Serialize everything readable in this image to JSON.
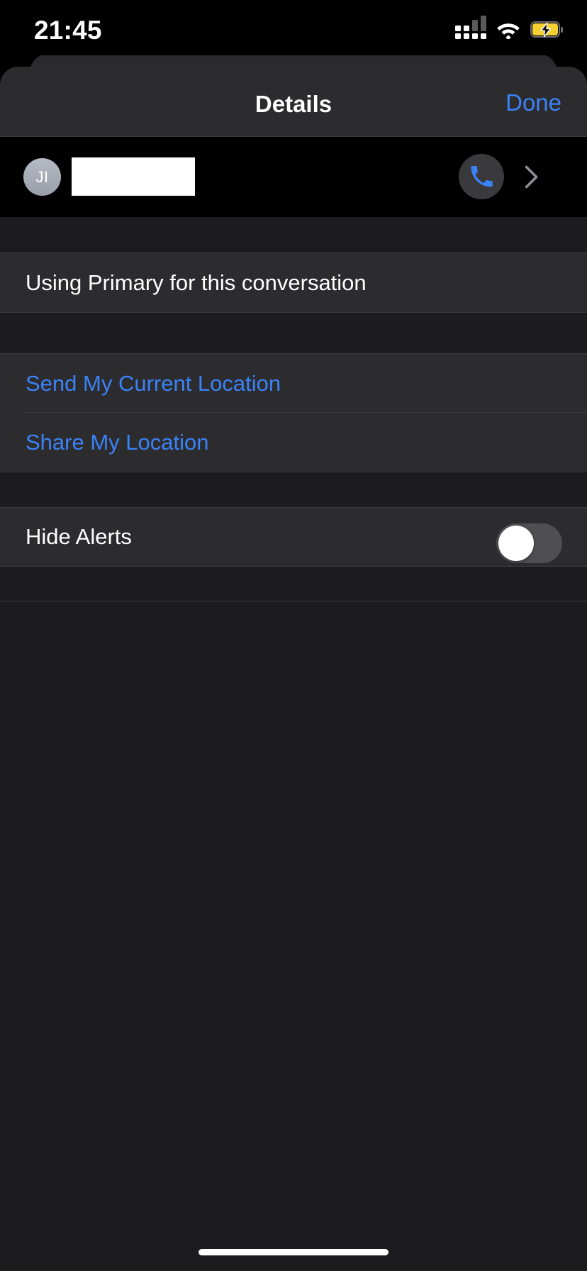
{
  "status_bar": {
    "time": "21:45",
    "signal_icon": "cellular-signal-dual-sim-icon",
    "signal_bars_primary": 4,
    "signal_bars_active": 2,
    "wifi_icon": "wifi-icon",
    "battery_icon": "battery-charging-icon",
    "battery_state": "charging",
    "battery_color": "#f5d033"
  },
  "sheet": {
    "nav": {
      "title": "Details",
      "done_label": "Done"
    },
    "contact": {
      "avatar_initials": "JI",
      "name_redacted": true,
      "call_icon": "phone-icon",
      "disclosure_icon": "chevron-right-icon"
    },
    "sections": [
      {
        "rows": [
          {
            "label": "Using Primary for this conversation",
            "style": "plain"
          }
        ]
      },
      {
        "rows": [
          {
            "label": "Send My Current Location",
            "style": "action"
          },
          {
            "label": "Share My Location",
            "style": "action"
          }
        ]
      },
      {
        "rows": [
          {
            "label": "Hide Alerts",
            "style": "toggle",
            "toggle_on": false
          }
        ]
      }
    ]
  },
  "colors": {
    "accent_blue": "#3b82f7",
    "sheet_bg": "#1c1c1e",
    "row_bg": "#2c2c2e",
    "separator": "#3a3a3c"
  },
  "home_indicator": "home-indicator"
}
